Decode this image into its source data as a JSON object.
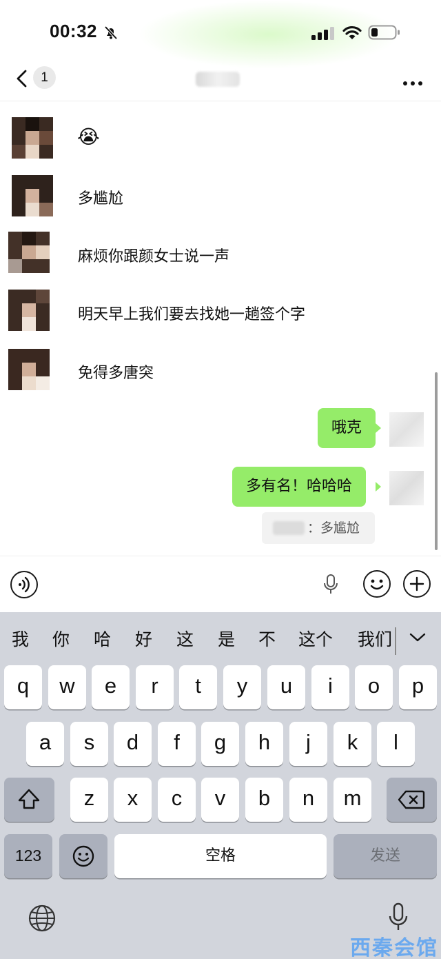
{
  "status_bar": {
    "time": "00:32"
  },
  "nav": {
    "unread_count": "1"
  },
  "messages": [
    {
      "side": "left",
      "text": "😭"
    },
    {
      "side": "left",
      "text": "多尴尬"
    },
    {
      "side": "left",
      "text": "麻烦你跟颜女士说一声"
    },
    {
      "side": "left",
      "text": "明天早上我们要去找她一趟签个字"
    },
    {
      "side": "left",
      "text": "免得多唐突"
    },
    {
      "side": "right",
      "text": "哦克"
    },
    {
      "side": "right",
      "text": "多有名！哈哈哈",
      "quote": "：多尴尬"
    }
  ],
  "keyboard": {
    "candidates": [
      "我",
      "你",
      "哈",
      "好",
      "这",
      "是",
      "不",
      "这个",
      "我们"
    ],
    "row1": [
      "q",
      "w",
      "e",
      "r",
      "t",
      "y",
      "u",
      "i",
      "o",
      "p"
    ],
    "row2": [
      "a",
      "s",
      "d",
      "f",
      "g",
      "h",
      "j",
      "k",
      "l"
    ],
    "row3": [
      "z",
      "x",
      "c",
      "v",
      "b",
      "n",
      "m"
    ],
    "numbers_key": "123",
    "space_key": "空格",
    "send_key": "发送"
  },
  "watermark": "西秦会馆",
  "colors": {
    "bubble_green": "#95ec69",
    "keyboard_bg": "#d2d5dc",
    "watermark_blue": "#5aa2f2"
  }
}
